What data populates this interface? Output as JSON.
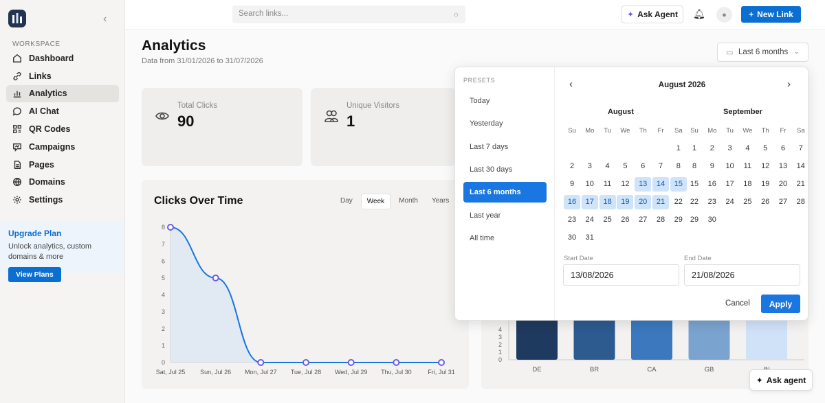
{
  "sidebar": {
    "workspace_label": "WORKSPACE",
    "items": [
      {
        "label": "Dashboard",
        "icon": "home-icon"
      },
      {
        "label": "Links",
        "icon": "link-icon"
      },
      {
        "label": "Analytics",
        "icon": "chart-icon",
        "active": true
      },
      {
        "label": "AI Chat",
        "icon": "chat-icon"
      },
      {
        "label": "QR Codes",
        "icon": "qr-icon"
      },
      {
        "label": "Campaigns",
        "icon": "campaign-icon"
      },
      {
        "label": "Pages",
        "icon": "page-icon"
      },
      {
        "label": "Domains",
        "icon": "globe-icon"
      },
      {
        "label": "Settings",
        "icon": "gear-icon"
      }
    ],
    "upgrade": {
      "title": "Upgrade Plan",
      "text": "Unlock analytics, custom domains & more",
      "button": "View Plans"
    }
  },
  "topbar": {
    "search_placeholder": "Search links...",
    "ask_agent": "Ask Agent",
    "new_link": "New Link"
  },
  "header": {
    "title": "Analytics",
    "subtitle": "Data from 31/01/2026 to 31/07/2026",
    "range": "Last 6 months"
  },
  "cards": [
    {
      "label": "Total Clicks",
      "value": "90"
    },
    {
      "label": "Unique Visitors",
      "value": "1"
    }
  ],
  "chart": {
    "title": "Clicks Over Time",
    "toggles": [
      "Day",
      "Week",
      "Month",
      "Years"
    ],
    "active_toggle": "Week"
  },
  "chart_data": [
    {
      "type": "area",
      "title": "Clicks Over Time",
      "categories": [
        "Sat, Jul 25",
        "Sun, Jul 26",
        "Mon, Jul 27",
        "Tue, Jul 28",
        "Wed, Jul 29",
        "Thu, Jul 30",
        "Fri, Jul 31"
      ],
      "values": [
        8,
        5,
        0,
        0,
        0,
        0,
        0
      ],
      "ylim": [
        0,
        8
      ],
      "yticks": [
        "0",
        "1",
        "2",
        "3",
        "4",
        "5",
        "6",
        "7",
        "8"
      ],
      "color": "#1a76e0"
    },
    {
      "type": "bar",
      "categories": [
        "DE",
        "BR",
        "CA",
        "GB",
        "IN"
      ],
      "yticks_visible": [
        "0",
        "1",
        "2",
        "3",
        "4"
      ],
      "colors": [
        "#1f3a5f",
        "#2d5a8f",
        "#3b78bd",
        "#7aa3cf",
        "#cfe2f8"
      ]
    }
  ],
  "datepicker": {
    "presets_title": "PRESETS",
    "presets": [
      "Today",
      "Yesterday",
      "Last 7 days",
      "Last 30 days",
      "Last 6 months",
      "Last year",
      "All time"
    ],
    "active_preset": "Last 6 months",
    "header": "August 2026",
    "dow": [
      "Su",
      "Mo",
      "Tu",
      "We",
      "Th",
      "Fr",
      "Sa"
    ],
    "months": [
      {
        "name": "August",
        "first_dow": 6,
        "days": 31,
        "selected": [
          13,
          14,
          15,
          16,
          17,
          18,
          19,
          20,
          21
        ]
      },
      {
        "name": "September",
        "first_dow": 0,
        "days": 30,
        "selected": []
      }
    ],
    "start_label": "Start Date",
    "end_label": "End Date",
    "start_value": "13/08/2026",
    "end_value": "21/08/2026",
    "cancel": "Cancel",
    "apply": "Apply"
  },
  "float_agent": "Ask agent"
}
